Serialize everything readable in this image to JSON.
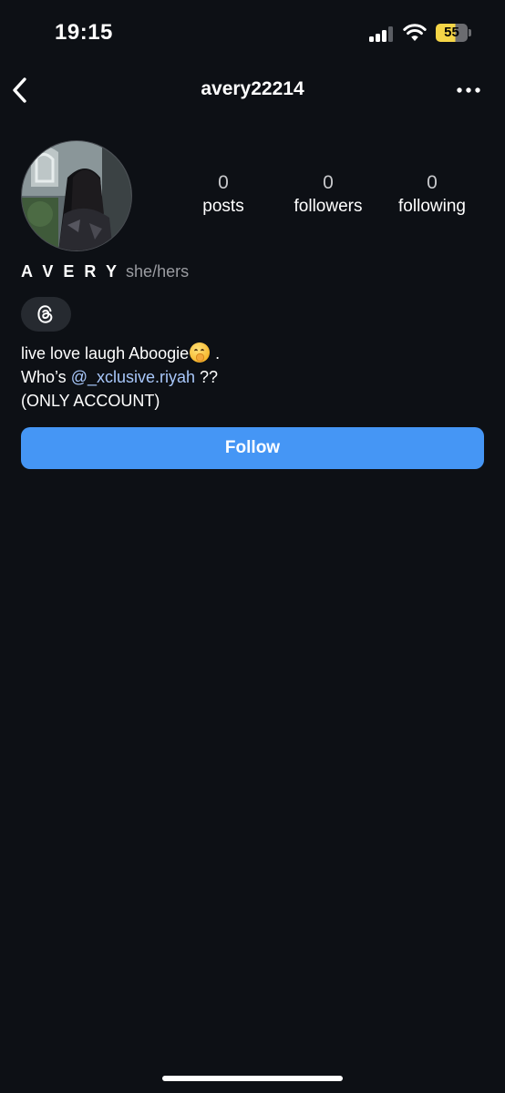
{
  "status_bar": {
    "time": "19:15",
    "battery_level": "55",
    "battery_color": "#f5d547",
    "signal_icon": "cellular-signal-icon",
    "wifi_icon": "wifi-icon"
  },
  "nav": {
    "title": "avery22214",
    "back_icon": "chevron-left-icon",
    "more_icon": "more-horizontal-icon"
  },
  "profile": {
    "stats": [
      {
        "value": "0",
        "label": "posts"
      },
      {
        "value": "0",
        "label": "followers"
      },
      {
        "value": "0",
        "label": "following"
      }
    ],
    "display_name": "A V E R Y",
    "pronouns": "she/hers",
    "threads_icon": "threads-logo-icon",
    "bio": {
      "line1_text": "live love laugh Aboogie",
      "line1_emoji": "face-with-hand-over-mouth-emoji",
      "line1_end": " .",
      "line2_prefix": "Who’s ",
      "line2_mention": "@_xclusive.riyah",
      "line2_suffix": " ??",
      "line3": "(ONLY ACCOUNT)"
    },
    "follow_label": "Follow"
  },
  "colors": {
    "background": "#0d1015",
    "accent": "#4596f5",
    "mention": "#a8c7fa",
    "badge_bg": "#262a30"
  }
}
